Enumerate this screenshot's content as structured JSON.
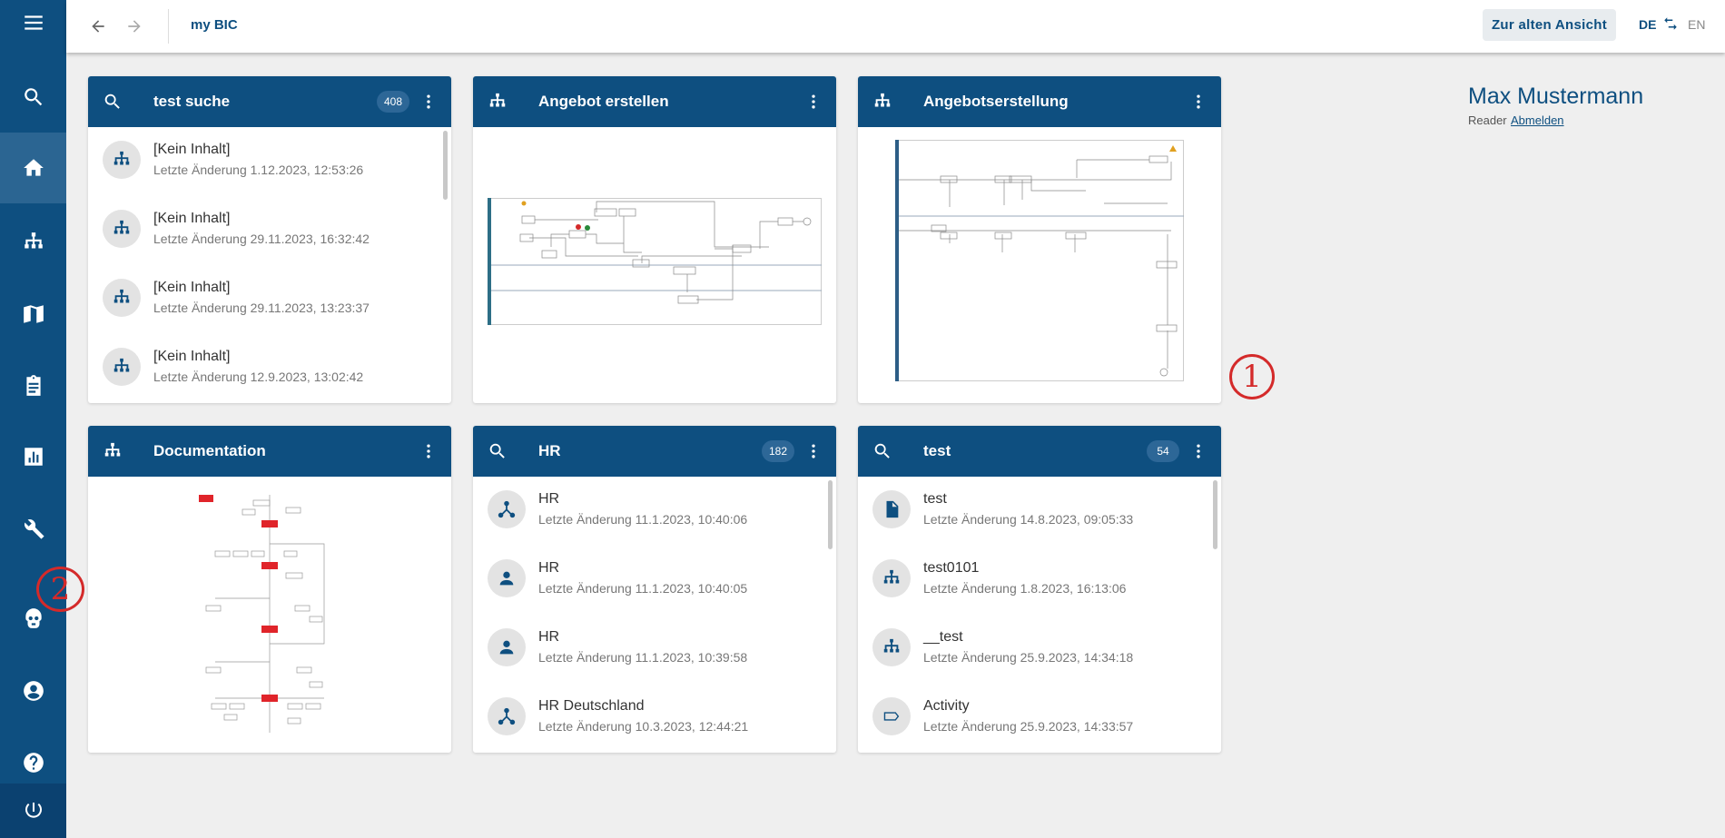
{
  "topbar": {
    "breadcrumb": "my BIC",
    "old_view_label": "Zur alten Ansicht",
    "lang_de": "DE",
    "lang_en": "EN"
  },
  "user": {
    "name": "Max Mustermann",
    "role": "Reader",
    "logout": "Abmelden"
  },
  "sidebar": {
    "items": [
      {
        "icon": "menu-icon"
      },
      {
        "icon": "search-icon"
      },
      {
        "icon": "home-icon",
        "active": true
      },
      {
        "icon": "hierarchy-icon"
      },
      {
        "icon": "book-icon"
      },
      {
        "icon": "clipboard-icon"
      },
      {
        "icon": "chart-icon"
      },
      {
        "icon": "wrench-icon"
      },
      {
        "icon": "robot-icon"
      },
      {
        "icon": "account-icon"
      },
      {
        "icon": "help-icon"
      },
      {
        "icon": "power-icon"
      }
    ]
  },
  "cards": {
    "test_suche": {
      "title": "test suche",
      "count": "408",
      "items": [
        {
          "title": "[Kein Inhalt]",
          "subtitle": "Letzte Änderung 1.12.2023, 12:53:26",
          "icon": "hierarchy-icon"
        },
        {
          "title": "[Kein Inhalt]",
          "subtitle": "Letzte Änderung 29.11.2023, 16:32:42",
          "icon": "hierarchy-icon"
        },
        {
          "title": "[Kein Inhalt]",
          "subtitle": "Letzte Änderung 29.11.2023, 13:23:37",
          "icon": "hierarchy-icon"
        },
        {
          "title": "[Kein Inhalt]",
          "subtitle": "Letzte Änderung 12.9.2023, 13:02:42",
          "icon": "hierarchy-icon"
        }
      ]
    },
    "angebot_erstellen": {
      "title": "Angebot erstellen"
    },
    "angebotserstellung": {
      "title": "Angebotserstellung"
    },
    "documentation": {
      "title": "Documentation"
    },
    "hr": {
      "title": "HR",
      "count": "182",
      "items": [
        {
          "title": "HR",
          "subtitle": "Letzte Änderung 11.1.2023, 10:40:06",
          "icon": "org-icon"
        },
        {
          "title": "HR",
          "subtitle": "Letzte Änderung 11.1.2023, 10:40:05",
          "icon": "person-icon"
        },
        {
          "title": "HR",
          "subtitle": "Letzte Änderung 11.1.2023, 10:39:58",
          "icon": "person-icon"
        },
        {
          "title": "HR Deutschland",
          "subtitle": "Letzte Änderung 10.3.2023, 12:44:21",
          "icon": "org-icon"
        }
      ]
    },
    "test": {
      "title": "test",
      "count": "54",
      "items": [
        {
          "title": "test",
          "subtitle": "Letzte Änderung 14.8.2023, 09:05:33",
          "icon": "document-icon"
        },
        {
          "title": "test0101",
          "subtitle": "Letzte Änderung 1.8.2023, 16:13:06",
          "icon": "hierarchy-icon"
        },
        {
          "title": "__test",
          "subtitle": "Letzte Änderung 25.9.2023, 14:34:18",
          "icon": "hierarchy-icon"
        },
        {
          "title": "Activity",
          "subtitle": "Letzte Änderung 25.9.2023, 14:33:57",
          "icon": "activity-icon"
        }
      ]
    }
  },
  "annotations": {
    "one": "1",
    "two": "2"
  },
  "colors": {
    "brand": "#0e4f80",
    "background": "#efefef",
    "annotation": "#d42a2a"
  }
}
